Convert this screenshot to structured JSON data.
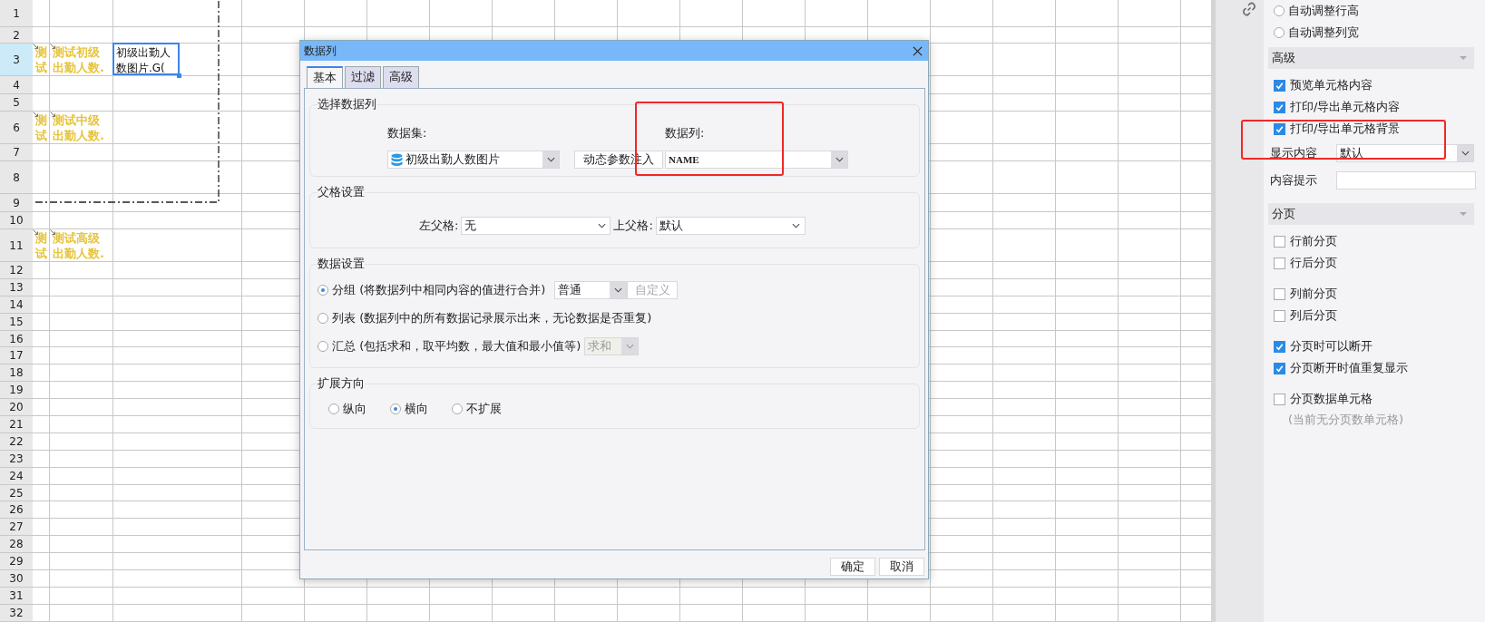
{
  "sheet": {
    "rows": [
      {
        "number": "1",
        "selected": false
      },
      {
        "number": "2",
        "selected": false
      },
      {
        "number": "3",
        "selected": true,
        "cells": [
          {
            "text": "测试",
            "kind": "field",
            "selected": false
          },
          {
            "text": "测试初级出勤人数.",
            "kind": "field",
            "selected": false
          },
          {
            "text": "初级出勤人数图片.G(",
            "kind": "plain",
            "selected": true
          }
        ]
      },
      {
        "number": "4",
        "selected": false
      },
      {
        "number": "5",
        "selected": false
      },
      {
        "number": "6",
        "selected": false,
        "cells": [
          {
            "text": "测试",
            "kind": "field",
            "selected": false
          },
          {
            "text": "测试中级出勤人数.",
            "kind": "field",
            "selected": false
          }
        ]
      },
      {
        "number": "7",
        "selected": false
      },
      {
        "number": "8",
        "selected": false
      },
      {
        "number": "9",
        "selected": false
      },
      {
        "number": "10",
        "selected": false
      },
      {
        "number": "11",
        "selected": false,
        "cells": [
          {
            "text": "测试",
            "kind": "field",
            "selected": false
          },
          {
            "text": "测试高级出勤人数.",
            "kind": "field",
            "selected": false
          }
        ]
      },
      {
        "number": "12",
        "selected": false
      },
      {
        "number": "13",
        "selected": false
      },
      {
        "number": "14",
        "selected": false
      },
      {
        "number": "15",
        "selected": false
      },
      {
        "number": "16",
        "selected": false
      },
      {
        "number": "17",
        "selected": false
      },
      {
        "number": "18",
        "selected": false
      },
      {
        "number": "19",
        "selected": false
      },
      {
        "number": "20",
        "selected": false
      },
      {
        "number": "21",
        "selected": false
      },
      {
        "number": "22",
        "selected": false
      },
      {
        "number": "23",
        "selected": false
      },
      {
        "number": "24",
        "selected": false
      },
      {
        "number": "25",
        "selected": false
      },
      {
        "number": "26",
        "selected": false
      },
      {
        "number": "27",
        "selected": false
      },
      {
        "number": "28",
        "selected": false
      },
      {
        "number": "29",
        "selected": false
      },
      {
        "number": "30",
        "selected": false
      },
      {
        "number": "31",
        "selected": false
      },
      {
        "number": "32",
        "selected": false
      }
    ]
  },
  "dialog": {
    "title": "数据列",
    "tabs": [
      {
        "label": "基本",
        "selected": true
      },
      {
        "label": "过滤",
        "selected": false
      },
      {
        "label": "高级",
        "selected": false
      }
    ],
    "column_select": {
      "title": "选择数据列",
      "dataset_label": "数据集:",
      "dataset_value": "初级出勤人数图片",
      "param_button": "动态参数注入",
      "column_label": "数据列:",
      "column_value": "NAME"
    },
    "parent": {
      "title": "父格设置",
      "left_label": "左父格:",
      "left_value": "无",
      "top_label": "上父格:",
      "top_value": "默认"
    },
    "data_settings": {
      "title": "数据设置",
      "options": [
        {
          "label": "分组 (将数据列中相同内容的值进行合并)",
          "selected": true,
          "select": {
            "value": "普通",
            "disabled": false
          },
          "button": {
            "label": "自定义",
            "disabled": true
          }
        },
        {
          "label": "列表 (数据列中的所有数据记录展示出来，无论数据是否重复)",
          "selected": false
        },
        {
          "label": "汇总 (包括求和，取平均数，最大值和最小值等)",
          "selected": false,
          "select": {
            "value": "求和",
            "disabled": true
          }
        }
      ]
    },
    "expand": {
      "title": "扩展方向",
      "options": [
        {
          "label": "纵向",
          "selected": false
        },
        {
          "label": "横向",
          "selected": true
        },
        {
          "label": "不扩展",
          "selected": false
        }
      ]
    },
    "buttons": [
      "确定",
      "取消"
    ]
  },
  "panel": {
    "top_options": [
      {
        "label": "自动调整行高",
        "selected": false
      },
      {
        "label": "自动调整列宽",
        "selected": false
      }
    ],
    "sections": [
      {
        "title": "高级",
        "groups": [
          [
            {
              "kind": "checkbox",
              "label": "预览单元格内容",
              "checked": true
            },
            {
              "kind": "checkbox",
              "label": "打印/导出单元格内容",
              "checked": true
            },
            {
              "kind": "checkbox",
              "label": "打印/导出单元格背景",
              "checked": true
            },
            {
              "kind": "select",
              "label": "显示内容",
              "value": "默认"
            },
            {
              "kind": "input",
              "label": "内容提示"
            }
          ]
        ]
      },
      {
        "title": "分页",
        "groups": [
          [
            {
              "kind": "checkbox",
              "label": "行前分页",
              "checked": false
            },
            {
              "kind": "checkbox",
              "label": "行后分页",
              "checked": false
            }
          ],
          [
            {
              "kind": "checkbox",
              "label": "列前分页",
              "checked": false
            },
            {
              "kind": "checkbox",
              "label": "列后分页",
              "checked": false
            }
          ],
          [
            {
              "kind": "checkbox",
              "label": "分页时可以断开",
              "checked": true
            },
            {
              "kind": "checkbox",
              "label": "分页断开时值重复显示",
              "checked": true
            }
          ],
          [
            {
              "kind": "checkbox",
              "label": "分页数据单元格",
              "checked": false
            },
            {
              "kind": "note",
              "text": "(当前无分页数单元格)"
            }
          ]
        ]
      }
    ]
  }
}
